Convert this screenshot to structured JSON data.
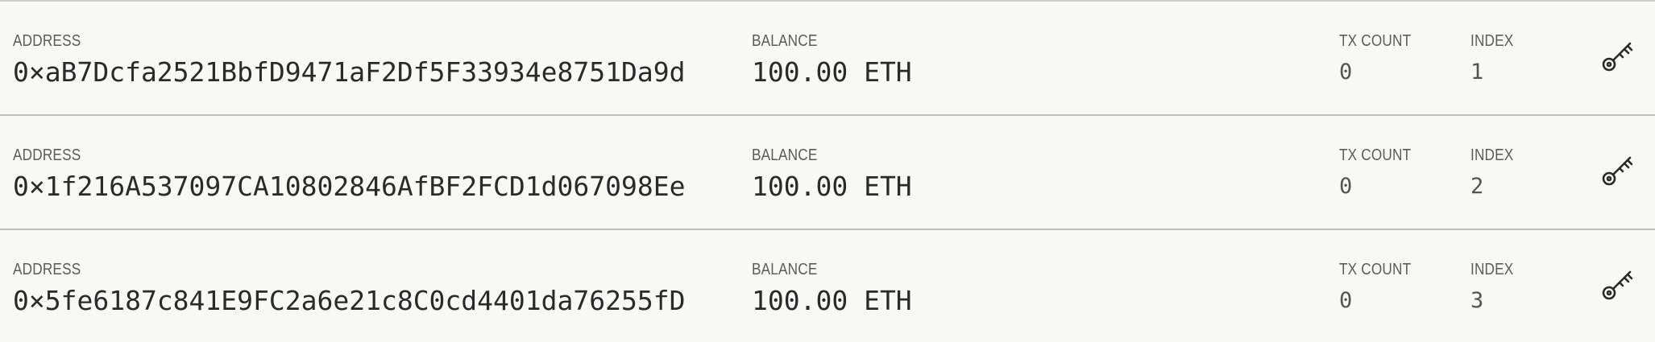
{
  "labels": {
    "address": "ADDRESS",
    "balance": "BALANCE",
    "tx_count": "TX COUNT",
    "index": "INDEX"
  },
  "accounts": [
    {
      "address": "0×aB7Dcfa2521BbfD9471aF2Df5F33934e8751Da9d",
      "balance": "100.00 ETH",
      "tx_count": "0",
      "index": "1",
      "icon": "key-icon"
    },
    {
      "address": "0×1f216A537097CA10802846AfBF2FCD1d067098Ee",
      "balance": "100.00 ETH",
      "tx_count": "0",
      "index": "2",
      "icon": "key-icon"
    },
    {
      "address": "0×5fe6187c841E9FC2a6e21c8C0cd4401da76255fD",
      "balance": "100.00 ETH",
      "tx_count": "0",
      "index": "3",
      "icon": "key-icon"
    }
  ],
  "colors": {
    "background": "#f9f8f5",
    "divider": "#c2c0bb",
    "label_text": "#5d5c59",
    "value_text": "#2b2a28"
  }
}
